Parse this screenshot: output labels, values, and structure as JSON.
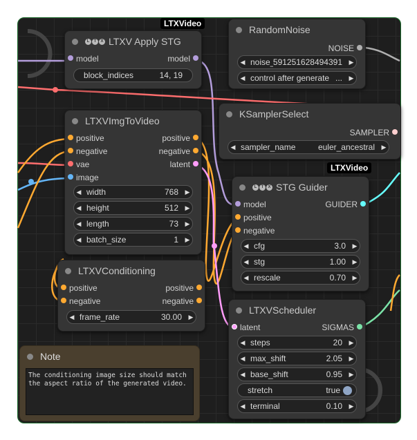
{
  "badges": {
    "apply_stg": "LTXVideo",
    "stg_guider": "LTXVideo"
  },
  "colors": {
    "model": "#b39ddb",
    "vae": "#ff6e6e",
    "image": "#64b5f6",
    "conditioning": "#ffa931",
    "latent": "#ff9cf9",
    "guider": "#66ffff",
    "noise": "#b0b0b0",
    "sampler": "#ffcfcf",
    "sigmas": "#7be3a8"
  },
  "apply_stg": {
    "title": "LTXV Apply STG",
    "in_model": "model",
    "out_model": "model",
    "block_indices_label": "block_indices",
    "block_indices_value": "14, 19"
  },
  "random_noise": {
    "title": "RandomNoise",
    "out": "NOISE",
    "noise_seed_label": "noise_seed",
    "noise_seed_value": "591251628494391",
    "control_label": "control after generate",
    "control_value": "..."
  },
  "ksampler_select": {
    "title": "KSamplerSelect",
    "out": "SAMPLER",
    "sampler_label": "sampler_name",
    "sampler_value": "euler_ancestral"
  },
  "img_to_video": {
    "title": "LTXVImgToVideo",
    "in_positive": "positive",
    "in_negative": "negative",
    "in_vae": "vae",
    "in_image": "image",
    "out_positive": "positive",
    "out_negative": "negative",
    "out_latent": "latent",
    "widgets": [
      {
        "label": "width",
        "value": "768"
      },
      {
        "label": "height",
        "value": "512"
      },
      {
        "label": "length",
        "value": "73"
      },
      {
        "label": "batch_size",
        "value": "1"
      }
    ]
  },
  "stg_guider": {
    "title": "STG Guider",
    "in_model": "model",
    "in_positive": "positive",
    "in_negative": "negative",
    "out": "GUIDER",
    "widgets": [
      {
        "label": "cfg",
        "value": "3.0"
      },
      {
        "label": "stg",
        "value": "1.00"
      },
      {
        "label": "rescale",
        "value": "0.70"
      }
    ]
  },
  "conditioning": {
    "title": "LTXVConditioning",
    "in_positive": "positive",
    "in_negative": "negative",
    "out_positive": "positive",
    "out_negative": "negative",
    "frame_rate_label": "frame_rate",
    "frame_rate_value": "30.00"
  },
  "scheduler": {
    "title": "LTXVScheduler",
    "in_latent": "latent",
    "out": "SIGMAS",
    "widgets": [
      {
        "label": "steps",
        "value": "20"
      },
      {
        "label": "max_shift",
        "value": "2.05"
      },
      {
        "label": "base_shift",
        "value": "0.95"
      }
    ],
    "stretch_label": "stretch",
    "stretch_value": "true",
    "terminal_label": "terminal",
    "terminal_value": "0.10"
  },
  "note": {
    "title": "Note",
    "text": "The conditioning image size should match the aspect ratio of the generated video."
  }
}
